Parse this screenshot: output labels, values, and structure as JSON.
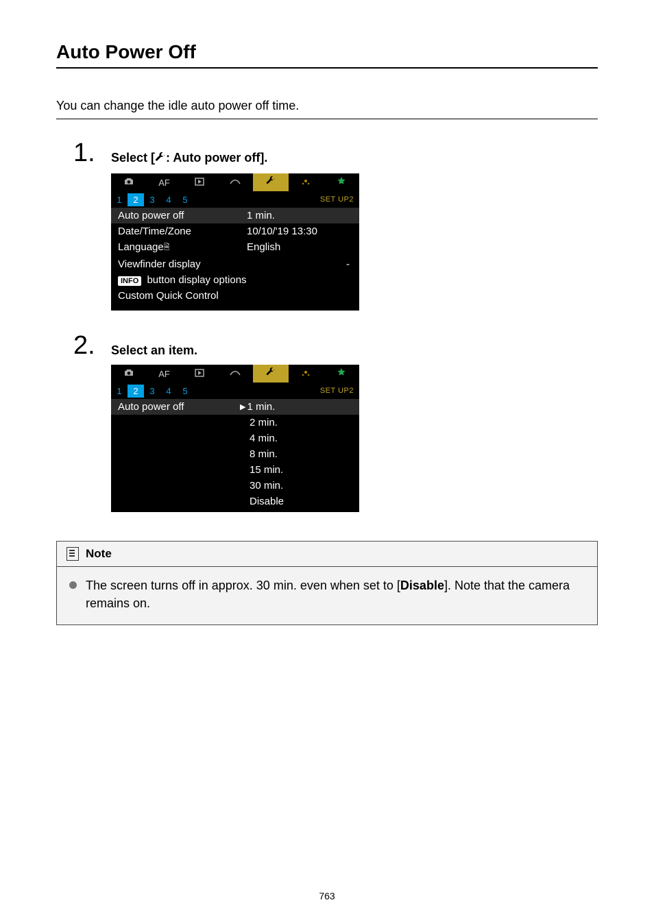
{
  "title": "Auto Power Off",
  "intro": "You can change the idle auto power off time.",
  "step1": {
    "title_prefix": "Select [",
    "title_suffix": ": Auto power off].",
    "tabs_setup_label": "SET UP2",
    "subtabs": [
      "1",
      "2",
      "3",
      "4",
      "5"
    ],
    "rows": {
      "auto_power_off_label": "Auto power off",
      "auto_power_off_value": "1 min.",
      "date_label": "Date/Time/Zone",
      "date_value": "10/10/'19 13:30",
      "lang_label": "Language",
      "lang_value": "English",
      "viewfinder_label": "Viewfinder display",
      "viewfinder_value": "-",
      "info_badge": "INFO",
      "info_label": " button display options",
      "custom_label": "Custom Quick Control"
    }
  },
  "step2": {
    "title": "Select an item.",
    "tabs_setup_label": "SET UP2",
    "subtabs": [
      "1",
      "2",
      "3",
      "4",
      "5"
    ],
    "option_label": "Auto power off",
    "options": [
      "1 min.",
      "2 min.",
      "4 min.",
      "8 min.",
      "15 min.",
      "30 min.",
      "Disable"
    ]
  },
  "note": {
    "heading": "Note",
    "body_before": "The screen turns off in approx. 30 min. even when set to [",
    "body_bold": "Disable",
    "body_after": "]. Note that the camera remains on."
  },
  "page_number": "763"
}
